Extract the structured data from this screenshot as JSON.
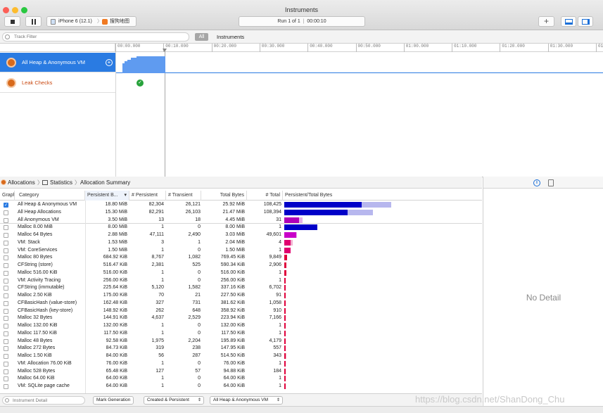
{
  "window": {
    "title": "Instruments"
  },
  "toolbar": {
    "device": "iPhone 6 (12.1)",
    "app": "搜狗地图",
    "run_label": "Run 1 of 1",
    "run_time": "00:00:10"
  },
  "filter": {
    "placeholder": "Track Filter",
    "all_label": "All",
    "scope_label": "Instruments"
  },
  "ruler": {
    "ticks": [
      "00:00.000",
      "00:10.000",
      "00:20.000",
      "00:30.000",
      "00:40.000",
      "00:50.000",
      "01:00.000",
      "01:10.000",
      "01:20.000",
      "01:30.000",
      "01:40"
    ]
  },
  "tracks": [
    {
      "label": "All Heap & Anonymous VM"
    },
    {
      "label": "Leak Checks"
    }
  ],
  "jumpbar": {
    "instrument": "Allocations",
    "view": "Statistics",
    "detail": "Allocation Summary"
  },
  "columns": {
    "graph": "Graph",
    "category": "Category",
    "persistent_bytes": "Persistent B...",
    "persistent": "# Persistent",
    "transient": "# Transient",
    "total_bytes": "Total Bytes",
    "total": "# Total",
    "ratio": "Persistent/Total Bytes"
  },
  "rows": [
    {
      "checked": true,
      "category": "All Heap & Anonymous VM",
      "persistent_bytes": "18.80 MiB",
      "persistent": "82,304",
      "transient": "26,121",
      "total_bytes": "25.92 MiB",
      "total": "108,425",
      "p_frac": 0.72,
      "t_frac": 1.0,
      "color": "#0000c8",
      "light": "#b7b7ee"
    },
    {
      "checked": false,
      "category": "All Heap Allocations",
      "persistent_bytes": "15.30 MiB",
      "persistent": "82,291",
      "transient": "26,103",
      "total_bytes": "21.47 MiB",
      "total": "108,394",
      "p_frac": 0.59,
      "t_frac": 0.83,
      "color": "#0000c8",
      "light": "#b7b7ee"
    },
    {
      "checked": false,
      "category": "All Anonymous VM",
      "persistent_bytes": "3.50 MiB",
      "persistent": "13",
      "transient": "18",
      "total_bytes": "4.45 MiB",
      "total": "31",
      "p_frac": 0.135,
      "t_frac": 0.172,
      "color": "#b000b8",
      "light": "#e6b0e8"
    },
    {
      "checked": false,
      "category": "Malloc 8.00 MiB",
      "persistent_bytes": "8.00 MiB",
      "persistent": "1",
      "transient": "0",
      "total_bytes": "8.00 MiB",
      "total": "1",
      "p_frac": 0.31,
      "t_frac": 0.31,
      "color": "#0000c8",
      "light": "#b7b7ee"
    },
    {
      "checked": false,
      "category": "Malloc 64 Bytes",
      "persistent_bytes": "2.88 MiB",
      "persistent": "47,111",
      "transient": "2,490",
      "total_bytes": "3.03 MiB",
      "total": "49,601",
      "p_frac": 0.111,
      "t_frac": 0.117,
      "color": "#c800c8",
      "light": "#e6b0e8"
    },
    {
      "checked": false,
      "category": "VM: Stack",
      "persistent_bytes": "1.53 MiB",
      "persistent": "3",
      "transient": "1",
      "total_bytes": "2.04 MiB",
      "total": "4",
      "p_frac": 0.059,
      "t_frac": 0.079,
      "color": "#e0006e",
      "light": "#f2b0cf"
    },
    {
      "checked": false,
      "category": "VM: CoreServices",
      "persistent_bytes": "1.50 MiB",
      "persistent": "1",
      "transient": "0",
      "total_bytes": "1.50 MiB",
      "total": "1",
      "p_frac": 0.058,
      "t_frac": 0.058,
      "color": "#e0006e",
      "light": "#f2b0cf"
    },
    {
      "checked": false,
      "category": "Malloc 80 Bytes",
      "persistent_bytes": "684.92 KiB",
      "persistent": "8,767",
      "transient": "1,082",
      "total_bytes": "769.45 KiB",
      "total": "9,849",
      "p_frac": 0.026,
      "t_frac": 0.029,
      "color": "#e0003c",
      "light": "#f2b0c0"
    },
    {
      "checked": false,
      "category": "CFString (store)",
      "persistent_bytes": "516.47 KiB",
      "persistent": "2,381",
      "transient": "525",
      "total_bytes": "590.34 KiB",
      "total": "2,906",
      "p_frac": 0.02,
      "t_frac": 0.022,
      "color": "#e0003c",
      "light": "#f2b0c0"
    },
    {
      "checked": false,
      "category": "Malloc 516.00 KiB",
      "persistent_bytes": "516.00 KiB",
      "persistent": "1",
      "transient": "0",
      "total_bytes": "516.00 KiB",
      "total": "1",
      "p_frac": 0.02,
      "t_frac": 0.02,
      "color": "#e0003c",
      "light": "#f2b0c0"
    },
    {
      "checked": false,
      "category": "VM: Activity Tracing",
      "persistent_bytes": "256.00 KiB",
      "persistent": "1",
      "transient": "0",
      "total_bytes": "256.00 KiB",
      "total": "1",
      "p_frac": 0.01,
      "t_frac": 0.01,
      "color": "#e0003c",
      "light": "#f2b0c0"
    },
    {
      "checked": false,
      "category": "CFString (immutable)",
      "persistent_bytes": "225.64 KiB",
      "persistent": "5,120",
      "transient": "1,582",
      "total_bytes": "337.16 KiB",
      "total": "6,702",
      "p_frac": 0.009,
      "t_frac": 0.013,
      "color": "#e0003c",
      "light": "#f2b0c0"
    },
    {
      "checked": false,
      "category": "Malloc 2.50 KiB",
      "persistent_bytes": "175.00 KiB",
      "persistent": "70",
      "transient": "21",
      "total_bytes": "227.50 KiB",
      "total": "91",
      "p_frac": 0.007,
      "t_frac": 0.009,
      "color": "#e0003c",
      "light": "#f2b0c0"
    },
    {
      "checked": false,
      "category": "CFBasicHash (value-store)",
      "persistent_bytes": "162.48 KiB",
      "persistent": "327",
      "transient": "731",
      "total_bytes": "381.62 KiB",
      "total": "1,058",
      "p_frac": 0.006,
      "t_frac": 0.014,
      "color": "#e0003c",
      "light": "#f2b0c0"
    },
    {
      "checked": false,
      "category": "CFBasicHash (key-store)",
      "persistent_bytes": "148.92 KiB",
      "persistent": "262",
      "transient": "648",
      "total_bytes": "358.92 KiB",
      "total": "910",
      "p_frac": 0.006,
      "t_frac": 0.014,
      "color": "#e0003c",
      "light": "#f2b0c0"
    },
    {
      "checked": false,
      "category": "Malloc 32 Bytes",
      "persistent_bytes": "144.91 KiB",
      "persistent": "4,637",
      "transient": "2,529",
      "total_bytes": "223.94 KiB",
      "total": "7,166",
      "p_frac": 0.006,
      "t_frac": 0.009,
      "color": "#e0003c",
      "light": "#f2b0c0"
    },
    {
      "checked": false,
      "category": "Malloc 132.00 KiB",
      "persistent_bytes": "132.00 KiB",
      "persistent": "1",
      "transient": "0",
      "total_bytes": "132.00 KiB",
      "total": "1",
      "p_frac": 0.005,
      "t_frac": 0.005,
      "color": "#e0003c",
      "light": "#f2b0c0"
    },
    {
      "checked": false,
      "category": "Malloc 117.50 KiB",
      "persistent_bytes": "117.50 KiB",
      "persistent": "1",
      "transient": "0",
      "total_bytes": "117.50 KiB",
      "total": "1",
      "p_frac": 0.005,
      "t_frac": 0.005,
      "color": "#e0003c",
      "light": "#f2b0c0"
    },
    {
      "checked": false,
      "category": "Malloc 48 Bytes",
      "persistent_bytes": "92.58 KiB",
      "persistent": "1,975",
      "transient": "2,204",
      "total_bytes": "195.89 KiB",
      "total": "4,179",
      "p_frac": 0.004,
      "t_frac": 0.008,
      "color": "#e0003c",
      "light": "#f2b0c0"
    },
    {
      "checked": false,
      "category": "Malloc 272 Bytes",
      "persistent_bytes": "84.73 KiB",
      "persistent": "319",
      "transient": "238",
      "total_bytes": "147.95 KiB",
      "total": "557",
      "p_frac": 0.003,
      "t_frac": 0.006,
      "color": "#e0003c",
      "light": "#f2b0c0"
    },
    {
      "checked": false,
      "category": "Malloc 1.50 KiB",
      "persistent_bytes": "84.00 KiB",
      "persistent": "56",
      "transient": "287",
      "total_bytes": "514.50 KiB",
      "total": "343",
      "p_frac": 0.003,
      "t_frac": 0.02,
      "color": "#e0003c",
      "light": "#f2b0c0"
    },
    {
      "checked": false,
      "category": "VM: Allocation 76.00 KiB",
      "persistent_bytes": "76.00 KiB",
      "persistent": "1",
      "transient": "0",
      "total_bytes": "76.00 KiB",
      "total": "1",
      "p_frac": 0.003,
      "t_frac": 0.003,
      "color": "#e0003c",
      "light": "#f2b0c0"
    },
    {
      "checked": false,
      "category": "Malloc 528 Bytes",
      "persistent_bytes": "65.48 KiB",
      "persistent": "127",
      "transient": "57",
      "total_bytes": "94.88 KiB",
      "total": "184",
      "p_frac": 0.003,
      "t_frac": 0.004,
      "color": "#e0003c",
      "light": "#f2b0c0"
    },
    {
      "checked": false,
      "category": "Malloc 64.00 KiB",
      "persistent_bytes": "64.00 KiB",
      "persistent": "1",
      "transient": "0",
      "total_bytes": "64.00 KiB",
      "total": "1",
      "p_frac": 0.002,
      "t_frac": 0.002,
      "color": "#e0003c",
      "light": "#f2b0c0"
    },
    {
      "checked": false,
      "category": "VM: SQLite page cache",
      "persistent_bytes": "64.00 KiB",
      "persistent": "1",
      "transient": "0",
      "total_bytes": "64.00 KiB",
      "total": "1",
      "p_frac": 0.002,
      "t_frac": 0.002,
      "color": "#e0003c",
      "light": "#f2b0c0"
    }
  ],
  "footer": {
    "detail_placeholder": "Instrument Detail",
    "mark_generation": "Mark Generation",
    "lifespan": "Created & Persistent",
    "allocation_type": "All Heap & Anonymous VM"
  },
  "detail": {
    "empty_text": "No Detail"
  },
  "watermark": "https://blog.csdn.net/ShanDong_Chu"
}
